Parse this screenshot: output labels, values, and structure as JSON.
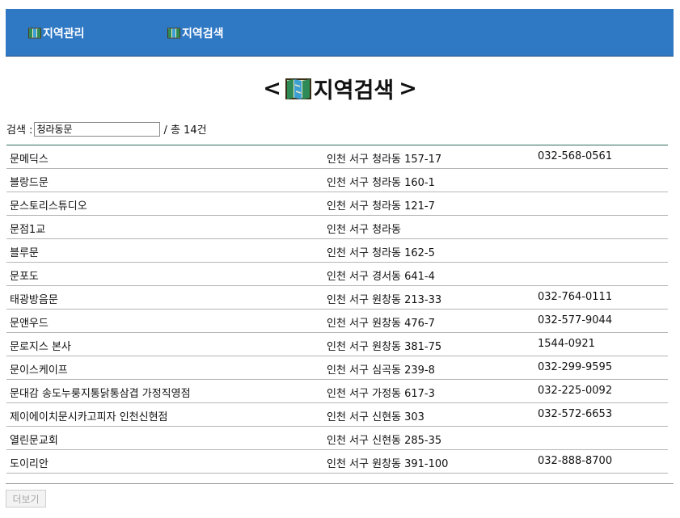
{
  "nav": {
    "items": [
      {
        "label": "지역관리"
      },
      {
        "label": "지역검색"
      }
    ]
  },
  "page_title": {
    "left": "<",
    "text": "지역검색",
    "right": ">"
  },
  "search": {
    "label": "검색 :",
    "value": "청라동문",
    "total": "/ 총 14건"
  },
  "results": [
    {
      "name": "문메딕스",
      "address": "인천 서구 청라동 157-17",
      "phone": "032-568-0561"
    },
    {
      "name": "블랑드문",
      "address": "인천 서구 청라동 160-1",
      "phone": ""
    },
    {
      "name": "문스토리스튜디오",
      "address": "인천 서구 청라동 121-7",
      "phone": ""
    },
    {
      "name": "문점1교",
      "address": "인천 서구 청라동",
      "phone": ""
    },
    {
      "name": "블루문",
      "address": "인천 서구 청라동 162-5",
      "phone": ""
    },
    {
      "name": "문포도",
      "address": "인천 서구 경서동 641-4",
      "phone": ""
    },
    {
      "name": "태광방음문",
      "address": "인천 서구 원창동 213-33",
      "phone": "032-764-0111"
    },
    {
      "name": "문앤우드",
      "address": "인천 서구 원창동 476-7",
      "phone": "032-577-9044"
    },
    {
      "name": "문로지스 본사",
      "address": "인천 서구 원창동 381-75",
      "phone": "1544-0921"
    },
    {
      "name": "문이스케이프",
      "address": "인천 서구 심곡동 239-8",
      "phone": "032-299-9595"
    },
    {
      "name": "문대감 송도누룽지통닭통삼겹 가정직영점",
      "address": "인천 서구 가정동 617-3",
      "phone": "032-225-0092"
    },
    {
      "name": "제이에이치문시카고피자 인천신현점",
      "address": "인천 서구 신현동 303",
      "phone": "032-572-6653"
    },
    {
      "name": "열린문교회",
      "address": "인천 서구 신현동 285-35",
      "phone": ""
    },
    {
      "name": "도이리안",
      "address": "인천 서구 원창동 391-100",
      "phone": "032-888-8700"
    }
  ],
  "more_button": "더보기",
  "colors": {
    "topbar": "#2f78c4",
    "map_icon": "#2e8b57"
  },
  "icons": {
    "nav": "map-icon",
    "title": "map-icon"
  }
}
